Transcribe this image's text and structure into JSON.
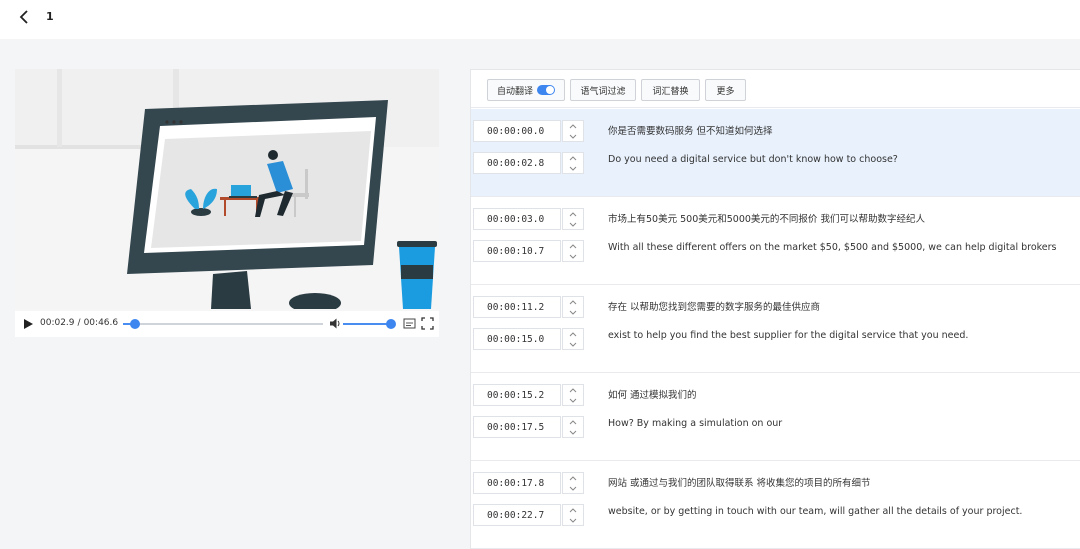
{
  "header": {
    "page_number": "1"
  },
  "player": {
    "current_time": "00:02.9",
    "separator": "/",
    "duration": "00:46.6",
    "progress": 0.062,
    "volume": 1.0
  },
  "toolbar": {
    "auto_translate_label": "自动翻译",
    "auto_translate_on": true,
    "filler_filter_label": "语气词过滤",
    "vocab_replace_label": "词汇替换",
    "more_label": "更多"
  },
  "subtitles": [
    {
      "start": "00:00:00.0",
      "end": "00:00:02.8",
      "zh": "你是否需要数码服务 但不知道如何选择",
      "en": "Do you need a digital service but don't know how to choose?",
      "active": true
    },
    {
      "start": "00:00:03.0",
      "end": "00:00:10.7",
      "zh": "市场上有50美元 500美元和5000美元的不同报价 我们可以帮助数字经纪人",
      "en": "With all these different offers on the market $50, $500 and $5000, we can help digital brokers",
      "active": false
    },
    {
      "start": "00:00:11.2",
      "end": "00:00:15.0",
      "zh": "存在 以帮助您找到您需要的数字服务的最佳供应商",
      "en": "exist to help you find the best supplier for the digital service that you need.",
      "active": false
    },
    {
      "start": "00:00:15.2",
      "end": "00:00:17.5",
      "zh": "如何 通过模拟我们的",
      "en": "How? By making a simulation on our",
      "active": false
    },
    {
      "start": "00:00:17.8",
      "end": "00:00:22.7",
      "zh": "网站 或通过与我们的团队取得联系 将收集您的项目的所有细节",
      "en": "website, or by getting in touch with our team, will gather all the details of your project.",
      "active": false
    }
  ],
  "colors": {
    "accent": "#3d86f0",
    "active_row": "#e8f1fc",
    "monitor_frame": "#34464e",
    "cup_blue": "#1b9ce0",
    "figure_blue": "#2a8fd6"
  },
  "icons": {
    "back": "chevron-left-icon",
    "play": "play-icon",
    "volume": "volume-icon",
    "subtitle": "subtitle-icon",
    "fullscreen": "fullscreen-icon",
    "spin_up": "chevron-up-icon",
    "spin_down": "chevron-down-icon"
  }
}
